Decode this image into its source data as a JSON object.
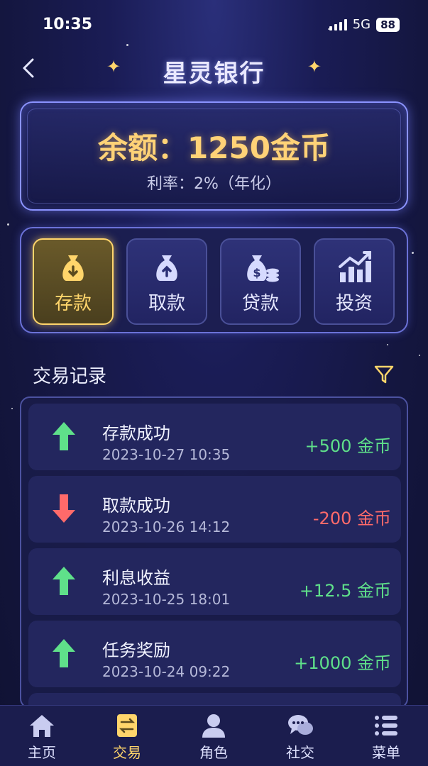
{
  "status_bar": {
    "time": "10:35",
    "network": "5G",
    "battery": "88"
  },
  "header": {
    "title": "星灵银行"
  },
  "balance": {
    "text": "余额：1250金币",
    "rate": "利率：2%（年化）"
  },
  "actions": [
    {
      "label": "存款",
      "icon": "money-bag-down-icon",
      "active": true
    },
    {
      "label": "取款",
      "icon": "money-bag-up-icon",
      "active": false
    },
    {
      "label": "贷款",
      "icon": "money-bag-coins-icon",
      "active": false
    },
    {
      "label": "投资",
      "icon": "chart-up-icon",
      "active": false
    }
  ],
  "transactions": {
    "header": "交易记录",
    "items": [
      {
        "title": "存款成功",
        "date": "2023-10-27 10:35",
        "amount": "+500 金币",
        "direction": "up"
      },
      {
        "title": "取款成功",
        "date": "2023-10-26 14:12",
        "amount": "-200 金币",
        "direction": "down"
      },
      {
        "title": "利息收益",
        "date": "2023-10-25 18:01",
        "amount": "+12.5 金币",
        "direction": "up"
      },
      {
        "title": "任务奖励",
        "date": "2023-10-24 09:22",
        "amount": "+1000 金币",
        "direction": "up"
      }
    ]
  },
  "bottom_nav": [
    {
      "label": "主页",
      "icon": "home-icon"
    },
    {
      "label": "交易",
      "icon": "transaction-icon",
      "active": true
    },
    {
      "label": "角色",
      "icon": "person-icon"
    },
    {
      "label": "社交",
      "icon": "chat-icon"
    },
    {
      "label": "菜单",
      "icon": "menu-list-icon"
    }
  ],
  "colors": {
    "accent": "#ffd56b",
    "positive": "#5fe08a",
    "negative": "#ff6a6a",
    "border": "#8b93ff"
  }
}
